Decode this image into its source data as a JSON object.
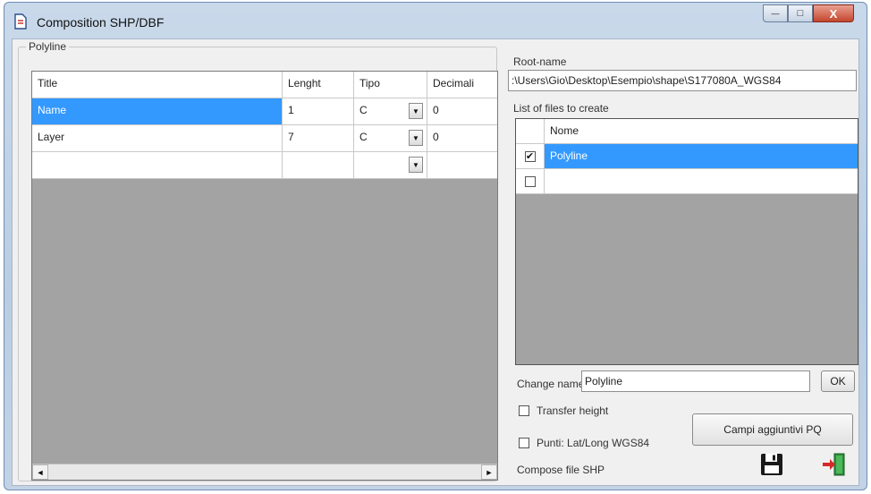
{
  "window": {
    "title": "Composition SHP/DBF"
  },
  "title_controls": {
    "minimize": "—",
    "maximize": "□",
    "close": "X"
  },
  "group": {
    "label": "Polyline"
  },
  "fields_table": {
    "headers": [
      "Title",
      "Lenght",
      "Tipo",
      "Decimali"
    ],
    "rows": [
      {
        "title": "Name",
        "length": "1",
        "tipo": "C",
        "decimali": "0"
      },
      {
        "title": "Layer",
        "length": "7",
        "tipo": "C",
        "decimali": "0"
      },
      {
        "title": "",
        "length": "",
        "tipo": "",
        "decimali": ""
      }
    ],
    "dropdown_glyph": "▼",
    "scroll_left": "◄",
    "scroll_right": "►"
  },
  "root": {
    "label": "Root-name",
    "value": ":\\Users\\Gio\\Desktop\\Esempio\\shape\\S177080A_WGS84"
  },
  "files": {
    "label": "List of files to create",
    "header": "Nome",
    "rows": [
      {
        "name": "Polyline",
        "checked": "✔"
      },
      {
        "name": "",
        "checked": ""
      }
    ]
  },
  "change_name": {
    "label": "Change name",
    "value": "Polyline",
    "ok": "OK"
  },
  "options": {
    "transfer_height": "Transfer height",
    "punti_latlong": "Punti: Lat/Long WGS84"
  },
  "campi_button": "Campi aggiuntivi PQ",
  "compose_label": "Compose file SHP",
  "colors": {
    "selection": "#3399ff",
    "grid_bg": "#a3a3a3"
  },
  "icons": {
    "save": "floppy-disk-icon",
    "exit": "exit-door-icon"
  }
}
